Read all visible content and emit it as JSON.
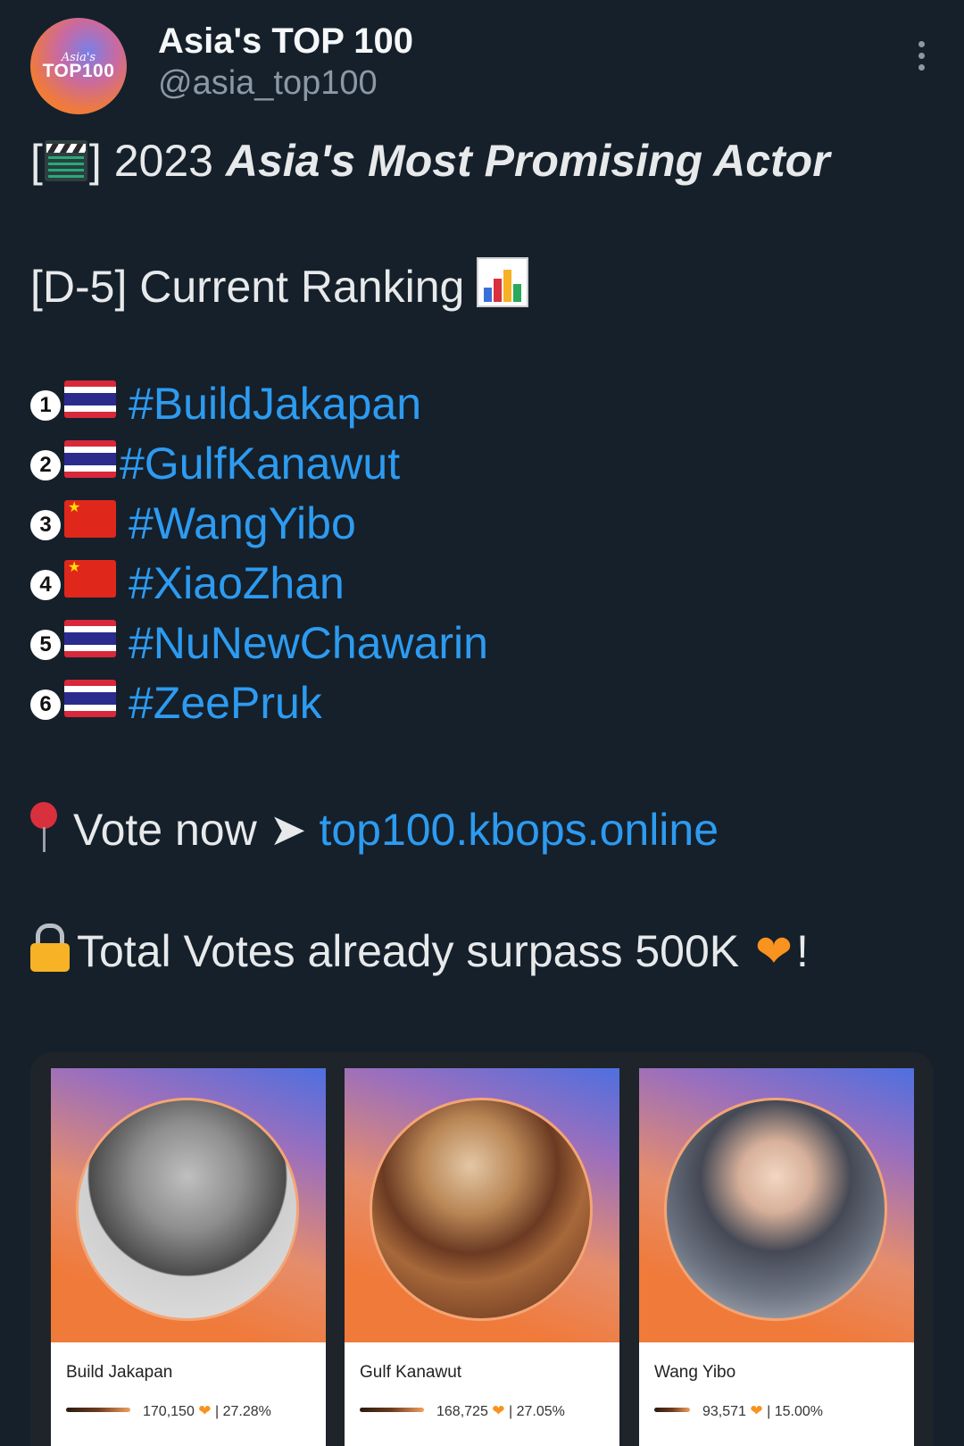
{
  "account": {
    "avatar_text_small": "Asia's",
    "avatar_text_big": "TOP100",
    "display_name": "Asia's TOP 100",
    "handle": "@asia_top100"
  },
  "tweet": {
    "title_prefix": "2023",
    "title_emphasis": "Asia's Most Promising Actor",
    "ranking_heading": "[D-5] Current Ranking",
    "ranking": [
      {
        "rank": "1",
        "flag": "thailand-flag",
        "hashtag": "#BuildJakapan"
      },
      {
        "rank": "2",
        "flag": "thailand-flag",
        "hashtag": "#GulfKanawut"
      },
      {
        "rank": "3",
        "flag": "china-flag",
        "hashtag": "#WangYibo"
      },
      {
        "rank": "4",
        "flag": "china-flag",
        "hashtag": "#XiaoZhan"
      },
      {
        "rank": "5",
        "flag": "thailand-flag",
        "hashtag": "#NuNewChawarin"
      },
      {
        "rank": "6",
        "flag": "thailand-flag",
        "hashtag": "#ZeePruk"
      }
    ],
    "vote_text": "Vote now",
    "vote_arrow": "➤",
    "vote_link": "top100.kbops.online",
    "total_votes_text": "Total Votes already surpass 500K",
    "total_votes_suffix": "!"
  },
  "candidates": [
    {
      "name": "Build Jakapan",
      "votes": "170,150",
      "percent": "| 27.28%"
    },
    {
      "name": "Gulf Kanawut",
      "votes": "168,725",
      "percent": "| 27.05%"
    },
    {
      "name": "Wang Yibo",
      "votes": "93,571",
      "percent": "| 15.00%"
    }
  ],
  "colors": {
    "background": "#15202b",
    "link": "#2d9bf0",
    "accent_orange": "#f7931e"
  }
}
